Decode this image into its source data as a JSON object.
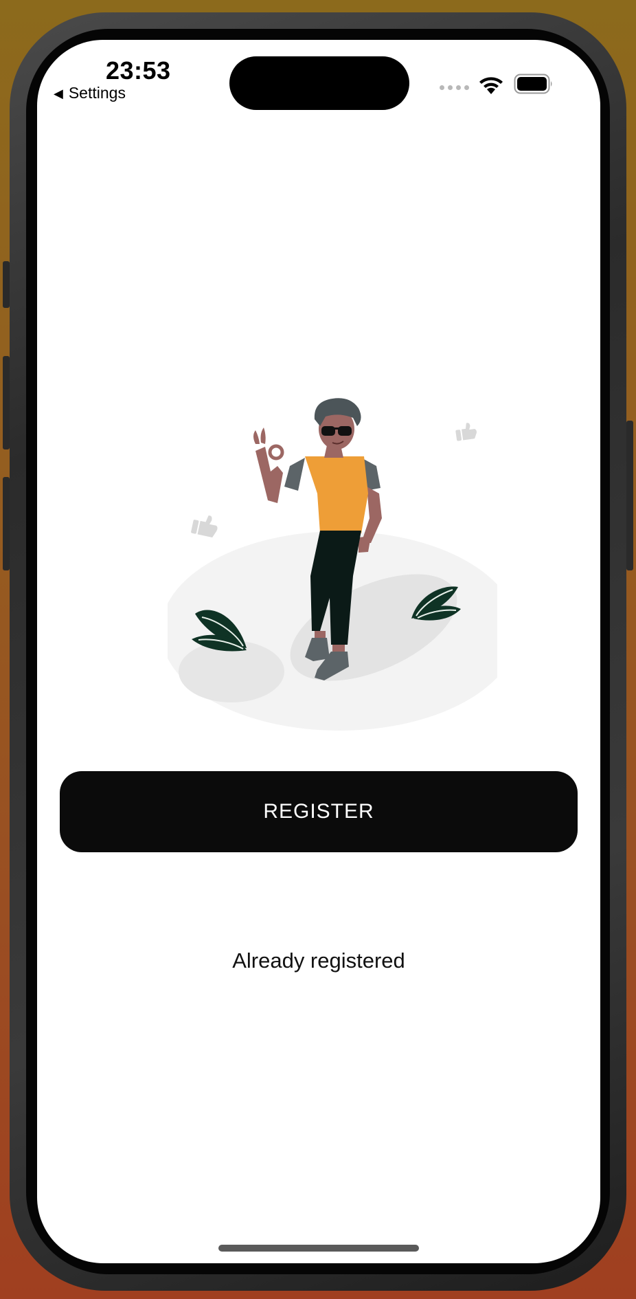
{
  "status_bar": {
    "time": "23:53",
    "back_label": "Settings"
  },
  "colors": {
    "background_top": "#8c6a1c",
    "background_bottom": "#a03f20",
    "button_bg": "#0b0b0b",
    "button_text": "#ffffff",
    "shirt": "#ee9e37",
    "pants": "#0b1a17",
    "skin": "#9c6763",
    "leaf": "#0f3325"
  },
  "icons": {
    "back": "triangle-left-icon",
    "signal": "cellular-signal-icon",
    "wifi": "wifi-icon",
    "battery": "battery-icon"
  },
  "main": {
    "register_label": "REGISTER",
    "already_label": "Already registered"
  }
}
